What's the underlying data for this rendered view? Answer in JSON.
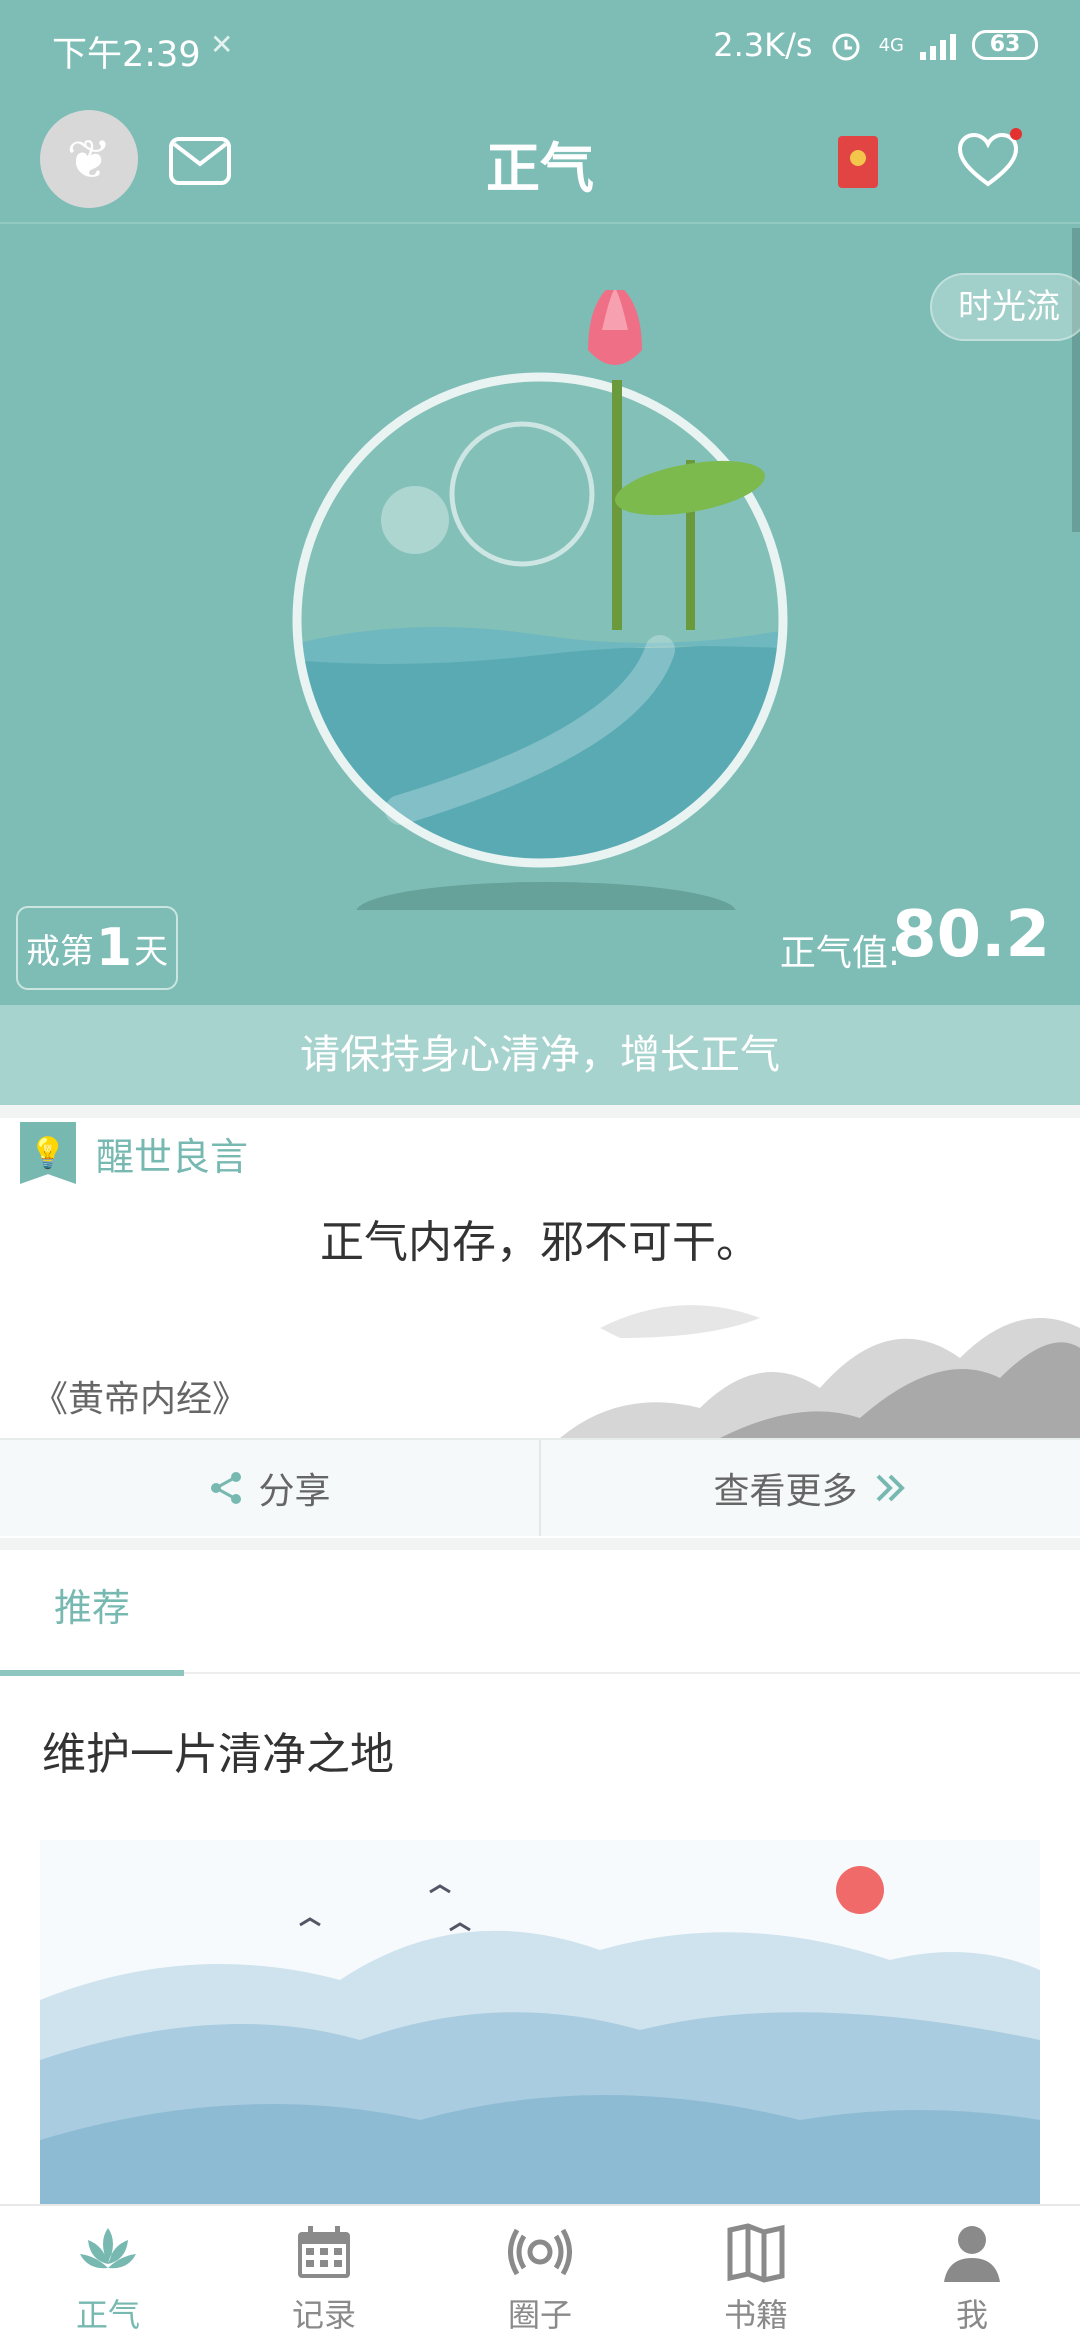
{
  "status_bar": {
    "time": "下午2:39",
    "net_speed": "2.3K/s",
    "network": "4G",
    "battery": "63"
  },
  "app_bar": {
    "title": "正气"
  },
  "hero": {
    "timeflow_label": "时光流",
    "days_prefix": "戒第",
    "days_count": "1",
    "days_suffix": "天",
    "zhengqi_label": "正气值:",
    "zhengqi_value": "80.2",
    "banner_text": "请保持身心清净，增长正气"
  },
  "quote": {
    "section_title": "醒世良言",
    "text": "正气内存，邪不可干。",
    "source": "《黄帝内经》",
    "share_label": "分享",
    "more_label": "查看更多"
  },
  "recommend": {
    "tab_label": "推荐",
    "article_title": "维护一片清净之地"
  },
  "bottom_nav": [
    {
      "label": "正气",
      "icon": "lotus-icon",
      "active": true
    },
    {
      "label": "记录",
      "icon": "calendar-icon",
      "active": false
    },
    {
      "label": "圈子",
      "icon": "broadcast-icon",
      "active": false
    },
    {
      "label": "书籍",
      "icon": "book-icon",
      "active": false
    },
    {
      "label": "我",
      "icon": "person-icon",
      "active": false
    }
  ],
  "colors": {
    "accent": "#7dbdb5",
    "banner": "#a7d3ce",
    "text": "#333333"
  }
}
